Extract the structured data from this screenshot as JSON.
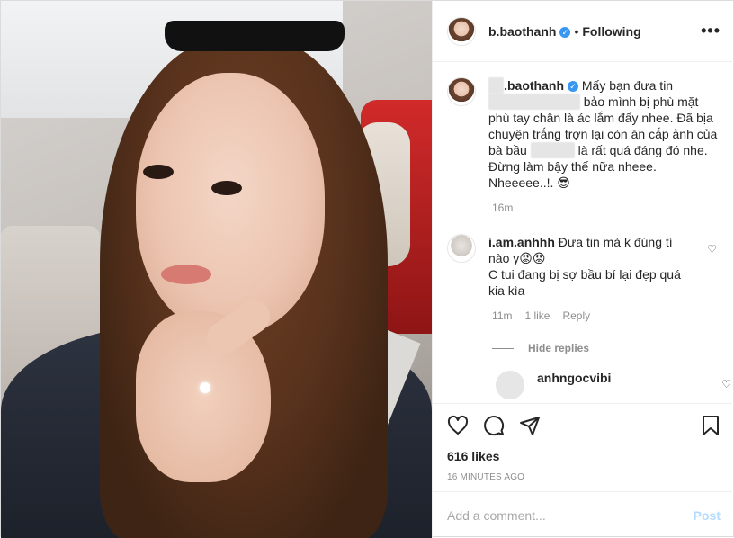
{
  "header": {
    "username": "b.baothanh",
    "verified": true,
    "separator": "•",
    "follow_label": "Following",
    "more_label": "•••"
  },
  "caption": {
    "username_prefix": "",
    "username": ".baothanh",
    "text_part1": "Mấy bạn đưa tin",
    "text_part2": "bảo mình bị phù mặt phù tay chân là ác lắm đấy nhee. Đã bịa chuyện trắng trợn lại còn ăn cắp ảnh của bà bầu",
    "text_part3": "là rất quá đáng đó nhe. Đừng làm bậy thế nữa nheee. Nheeeee..!.",
    "emoji": "😎",
    "time": "16m"
  },
  "comment": {
    "username": "i.am.anhhh",
    "text_line1": "Đưa tin mà k đúng tí nào y😡😡",
    "text_line2": "C tui đang bị sợ bầu bí lại đẹp quá kia kìa",
    "time": "11m",
    "likes": "1 like",
    "reply_label": "Reply",
    "hide_replies_label": "Hide replies"
  },
  "reply": {
    "username": "anhngocvibi"
  },
  "actions": {
    "likes_count": "616 likes",
    "time_ago": "16 MINUTES AGO"
  },
  "add_comment": {
    "placeholder": "Add a comment...",
    "post_label": "Post"
  },
  "colors": {
    "verified": "#3897f0",
    "post_disabled": "#b3dbff",
    "meta_gray": "#8e8e8e"
  }
}
